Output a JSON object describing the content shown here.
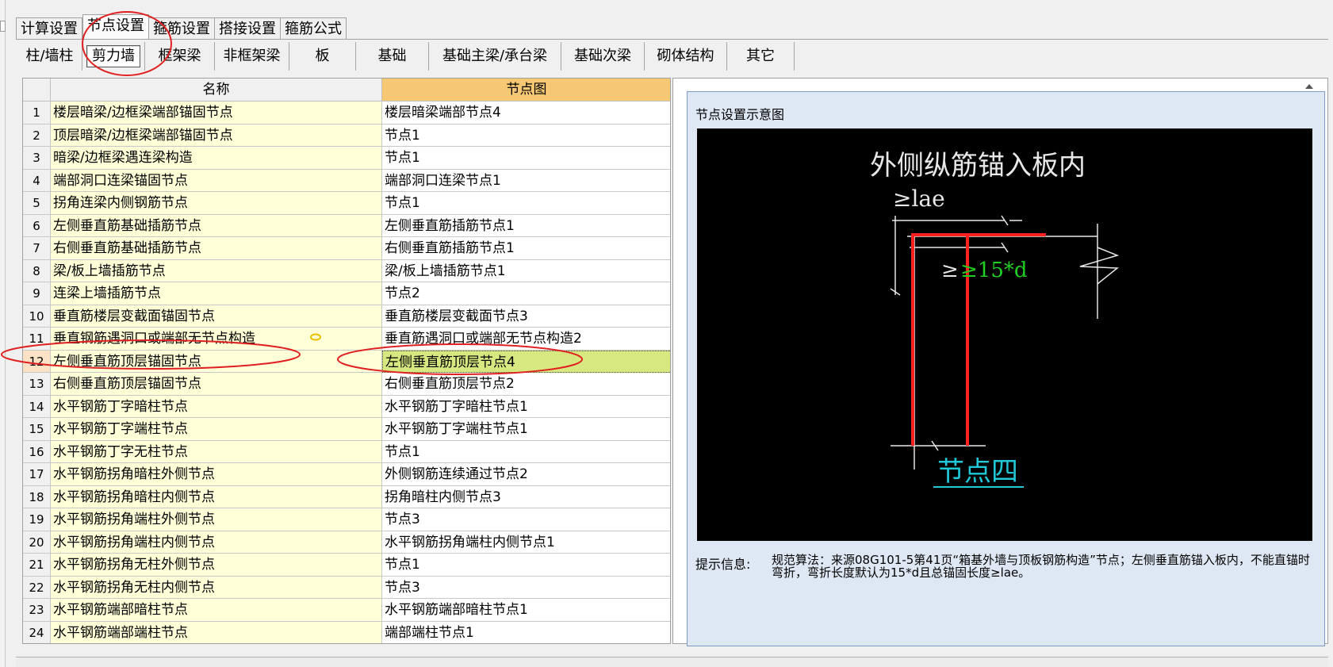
{
  "main_tabs": [
    {
      "label": "计算设置"
    },
    {
      "label": "节点设置"
    },
    {
      "label": "箍筋设置"
    },
    {
      "label": "搭接设置"
    },
    {
      "label": "箍筋公式"
    }
  ],
  "sub_tabs": [
    {
      "label": "柱/墙柱"
    },
    {
      "label": "剪力墙"
    },
    {
      "label": "框架梁"
    },
    {
      "label": "非框架梁"
    },
    {
      "label": "板"
    },
    {
      "label": "基础"
    },
    {
      "label": "基础主梁/承台梁"
    },
    {
      "label": "基础次梁"
    },
    {
      "label": "砌体结构"
    },
    {
      "label": "其它"
    }
  ],
  "grid": {
    "header_name": "名称",
    "header_node": "节点图",
    "rows": [
      {
        "num": "1",
        "name": "楼层暗梁/边框梁端部锚固节点",
        "node": "楼层暗梁端部节点4"
      },
      {
        "num": "2",
        "name": "顶层暗梁/边框梁端部锚固节点",
        "node": "节点1"
      },
      {
        "num": "3",
        "name": "暗梁/边框梁遇连梁构造",
        "node": "节点1"
      },
      {
        "num": "4",
        "name": "端部洞口连梁锚固节点",
        "node": "端部洞口连梁节点1"
      },
      {
        "num": "5",
        "name": "拐角连梁内侧钢筋节点",
        "node": "节点1"
      },
      {
        "num": "6",
        "name": "左侧垂直筋基础插筋节点",
        "node": "左侧垂直筋插筋节点1"
      },
      {
        "num": "7",
        "name": "右侧垂直筋基础插筋节点",
        "node": "右侧垂直筋插筋节点1"
      },
      {
        "num": "8",
        "name": "梁/板上墙插筋节点",
        "node": "梁/板上墙插筋节点1"
      },
      {
        "num": "9",
        "name": "连梁上墙插筋节点",
        "node": "节点2"
      },
      {
        "num": "10",
        "name": "垂直筋楼层变截面锚固节点",
        "node": "垂直筋楼层变截面节点3"
      },
      {
        "num": "11",
        "name": "垂直钢筋遇洞口或端部无节点构造",
        "node": "垂直筋遇洞口或端部无节点构造2"
      },
      {
        "num": "12",
        "name": "左侧垂直筋顶层锚固节点",
        "node": "左侧垂直筋顶层节点4"
      },
      {
        "num": "13",
        "name": "右侧垂直筋顶层锚固节点",
        "node": "右侧垂直筋顶层节点2"
      },
      {
        "num": "14",
        "name": "水平钢筋丁字暗柱节点",
        "node": "水平钢筋丁字暗柱节点1"
      },
      {
        "num": "15",
        "name": "水平钢筋丁字端柱节点",
        "node": "水平钢筋丁字端柱节点1"
      },
      {
        "num": "16",
        "name": "水平钢筋丁字无柱节点",
        "node": "节点1"
      },
      {
        "num": "17",
        "name": "水平钢筋拐角暗柱外侧节点",
        "node": "外侧钢筋连续通过节点2"
      },
      {
        "num": "18",
        "name": "水平钢筋拐角暗柱内侧节点",
        "node": "拐角暗柱内侧节点3"
      },
      {
        "num": "19",
        "name": "水平钢筋拐角端柱外侧节点",
        "node": "节点3"
      },
      {
        "num": "20",
        "name": "水平钢筋拐角端柱内侧节点",
        "node": "水平钢筋拐角端柱内侧节点1"
      },
      {
        "num": "21",
        "name": "水平钢筋拐角无柱外侧节点",
        "node": "节点1"
      },
      {
        "num": "22",
        "name": "水平钢筋拐角无柱内侧节点",
        "node": "节点3"
      },
      {
        "num": "23",
        "name": "水平钢筋端部暗柱节点",
        "node": "水平钢筋端部暗柱节点1"
      },
      {
        "num": "24",
        "name": "水平钢筋端部端柱节点",
        "node": "端部端柱节点1"
      }
    ]
  },
  "panel": {
    "title": "节点设置示意图",
    "diagram_title": "外侧纵筋锚入板内",
    "dim_lae": "≥lae",
    "dim_15d": "≥15*d",
    "node_caption": "节点四",
    "info_label": "提示信息:",
    "info_text": "规范算法：来源08G101-5第41页“箱基外墙与顶板钢筋构造”节点；左侧垂直筋锚入板内，不能直锚时弯折，弯折长度默认为15*d且总锚固长度≥lae。"
  },
  "colors": {
    "header_node_bg": "#f7c873",
    "name_cell_bg": "#ffffd8",
    "selected_node_bg": "#d8e880",
    "annotation_red": "#e02020",
    "rebar_red": "#ff2020",
    "dim_green": "#20d020",
    "caption_cyan": "#20c8d8"
  }
}
